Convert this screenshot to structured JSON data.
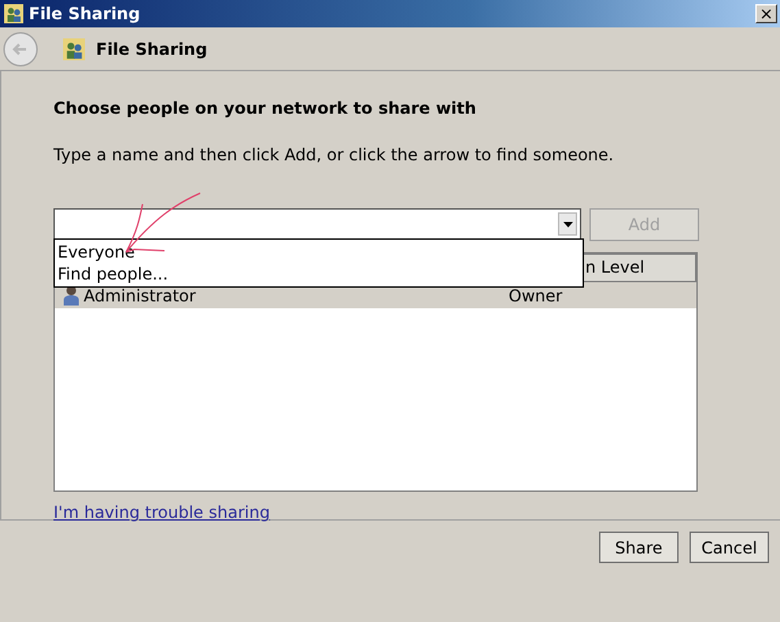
{
  "window": {
    "title": "File Sharing",
    "close": "×"
  },
  "header": {
    "title": "File Sharing"
  },
  "heading": "Choose people on your network to share with",
  "instruction": "Type a name and then click Add, or click the arrow to find someone.",
  "name_combo": {
    "expanded": true,
    "options": [
      "Everyone",
      "Find people..."
    ]
  },
  "add_button": {
    "label": "Add",
    "disabled": true
  },
  "table": {
    "columns": [
      "n Level"
    ],
    "rows": [
      {
        "name": "Administrator",
        "level": "Owner",
        "selected": true
      }
    ]
  },
  "link": "I'm having trouble sharing",
  "buttons": [
    {
      "label": "Share"
    },
    {
      "label": "Cancel"
    }
  ]
}
